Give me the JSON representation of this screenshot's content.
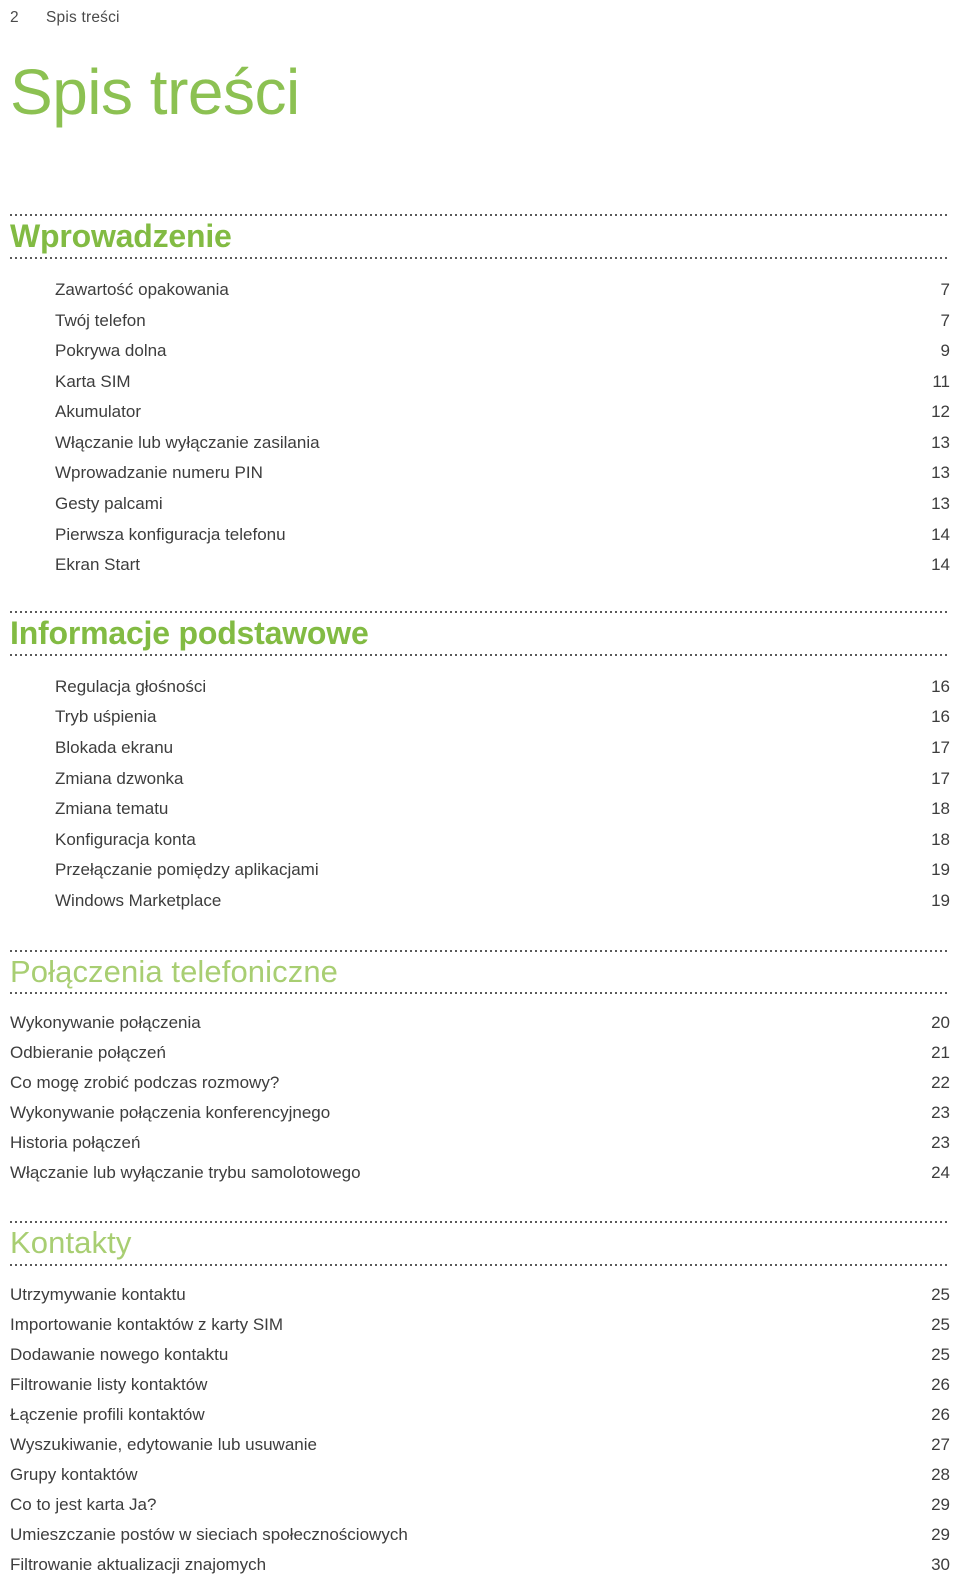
{
  "header": {
    "folio": "2",
    "title": "Spis treści"
  },
  "page_title": "Spis treści",
  "colors": {
    "heading_bold_green": "#82bb43",
    "heading_light_green": "#a8ce72",
    "title_green": "#8cc152",
    "body_text": "#3d3d3d",
    "rule_dots": "#5a5a5a"
  },
  "sections": [
    {
      "id": "wprowadzenie",
      "title": "Wprowadzenie",
      "style": "bold",
      "entries": [
        {
          "label": "Zawartość opakowania",
          "page": "7"
        },
        {
          "label": "Twój telefon",
          "page": "7"
        },
        {
          "label": "Pokrywa dolna",
          "page": "9"
        },
        {
          "label": "Karta SIM",
          "page": "11"
        },
        {
          "label": "Akumulator",
          "page": "12"
        },
        {
          "label": "Włączanie lub wyłączanie zasilania",
          "page": "13"
        },
        {
          "label": "Wprowadzanie numeru PIN",
          "page": "13"
        },
        {
          "label": "Gesty palcami",
          "page": "13"
        },
        {
          "label": "Pierwsza konfiguracja telefonu",
          "page": "14"
        },
        {
          "label": "Ekran Start",
          "page": "14"
        }
      ]
    },
    {
      "id": "informacje",
      "title": "Informacje podstawowe",
      "style": "bold",
      "entries": [
        {
          "label": "Regulacja głośności",
          "page": "16"
        },
        {
          "label": "Tryb uśpienia",
          "page": "16"
        },
        {
          "label": "Blokada ekranu",
          "page": "17"
        },
        {
          "label": "Zmiana dzwonka",
          "page": "17"
        },
        {
          "label": "Zmiana tematu",
          "page": "18"
        },
        {
          "label": "Konfiguracja konta",
          "page": "18"
        },
        {
          "label": "Przełączanie pomiędzy aplikacjami",
          "page": "19"
        },
        {
          "label": "Windows Marketplace",
          "page": "19"
        }
      ]
    },
    {
      "id": "polaczenia",
      "title": "Połączenia telefoniczne",
      "style": "light",
      "entries": [
        {
          "label": "Wykonywanie połączenia",
          "page": "20"
        },
        {
          "label": "Odbieranie połączeń",
          "page": "21"
        },
        {
          "label": "Co mogę zrobić podczas rozmowy?",
          "page": "22"
        },
        {
          "label": "Wykonywanie połączenia konferencyjnego",
          "page": "23"
        },
        {
          "label": "Historia połączeń",
          "page": "23"
        },
        {
          "label": "Włączanie lub wyłączanie trybu samolotowego",
          "page": "24"
        }
      ]
    },
    {
      "id": "kontakty",
      "title": "Kontakty",
      "style": "light",
      "entries": [
        {
          "label": "Utrzymywanie kontaktu",
          "page": "25"
        },
        {
          "label": "Importowanie kontaktów z karty SIM",
          "page": "25"
        },
        {
          "label": "Dodawanie nowego kontaktu",
          "page": "25"
        },
        {
          "label": "Filtrowanie listy kontaktów",
          "page": "26"
        },
        {
          "label": "Łączenie profili kontaktów",
          "page": "26"
        },
        {
          "label": "Wyszukiwanie, edytowanie lub usuwanie",
          "page": "27"
        },
        {
          "label": "Grupy kontaktów",
          "page": "28"
        },
        {
          "label": "Co to jest karta Ja?",
          "page": "29"
        },
        {
          "label": "Umieszczanie postów w sieciach społecznościowych",
          "page": "29"
        },
        {
          "label": "Filtrowanie aktualizacji znajomych",
          "page": "30"
        }
      ]
    }
  ]
}
